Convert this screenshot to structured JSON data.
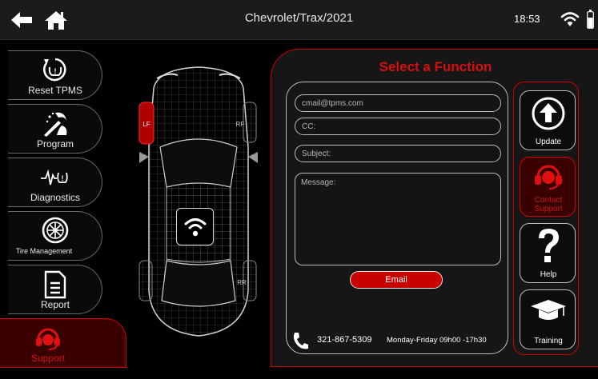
{
  "topbar": {
    "title": "Chevrolet/Trax/2021",
    "time": "18:53",
    "icons": [
      "back-arrow-icon",
      "home-icon",
      "wifi-icon",
      "battery-icon"
    ]
  },
  "sidebar": {
    "items": [
      {
        "label": "Reset TPMS",
        "icon": "tpms-reset-icon"
      },
      {
        "label": "Program",
        "icon": "program-wand-icon"
      },
      {
        "label": "Diagnostics",
        "icon": "diagnostics-pulse-icon"
      },
      {
        "label": "Tire Management",
        "icon": "tire-icon"
      },
      {
        "label": "Report",
        "icon": "report-document-icon"
      },
      {
        "label": "Support",
        "icon": "headset-icon",
        "active": true
      }
    ]
  },
  "car": {
    "wheel_labels": {
      "lf": "LF",
      "rf": "RF",
      "rr": "RR"
    },
    "active_wheel_color": "#c00000"
  },
  "main": {
    "title": "Select a Function",
    "form": {
      "email_placeholder": "cmail@tpms.com",
      "cc_placeholder": "CC:",
      "subject_placeholder": "Subject:",
      "message_placeholder": "Message:",
      "email_button": "Email",
      "phone": "321-867-5309",
      "hours": "Monday-Friday 09h00 -17h30"
    },
    "functions": [
      {
        "label": "Update",
        "icon": "upload-arrow-icon"
      },
      {
        "label": "Contact Support",
        "icon": "headset-icon",
        "active": true
      },
      {
        "label": "Help",
        "icon": "question-mark-icon"
      },
      {
        "label": "Training",
        "icon": "graduation-cap-icon"
      }
    ]
  },
  "colors": {
    "accent_red": "#d00000",
    "active_bg": "#3a0000",
    "panel_bg": "#161616",
    "topbar_bg": "#1b1b1b"
  }
}
